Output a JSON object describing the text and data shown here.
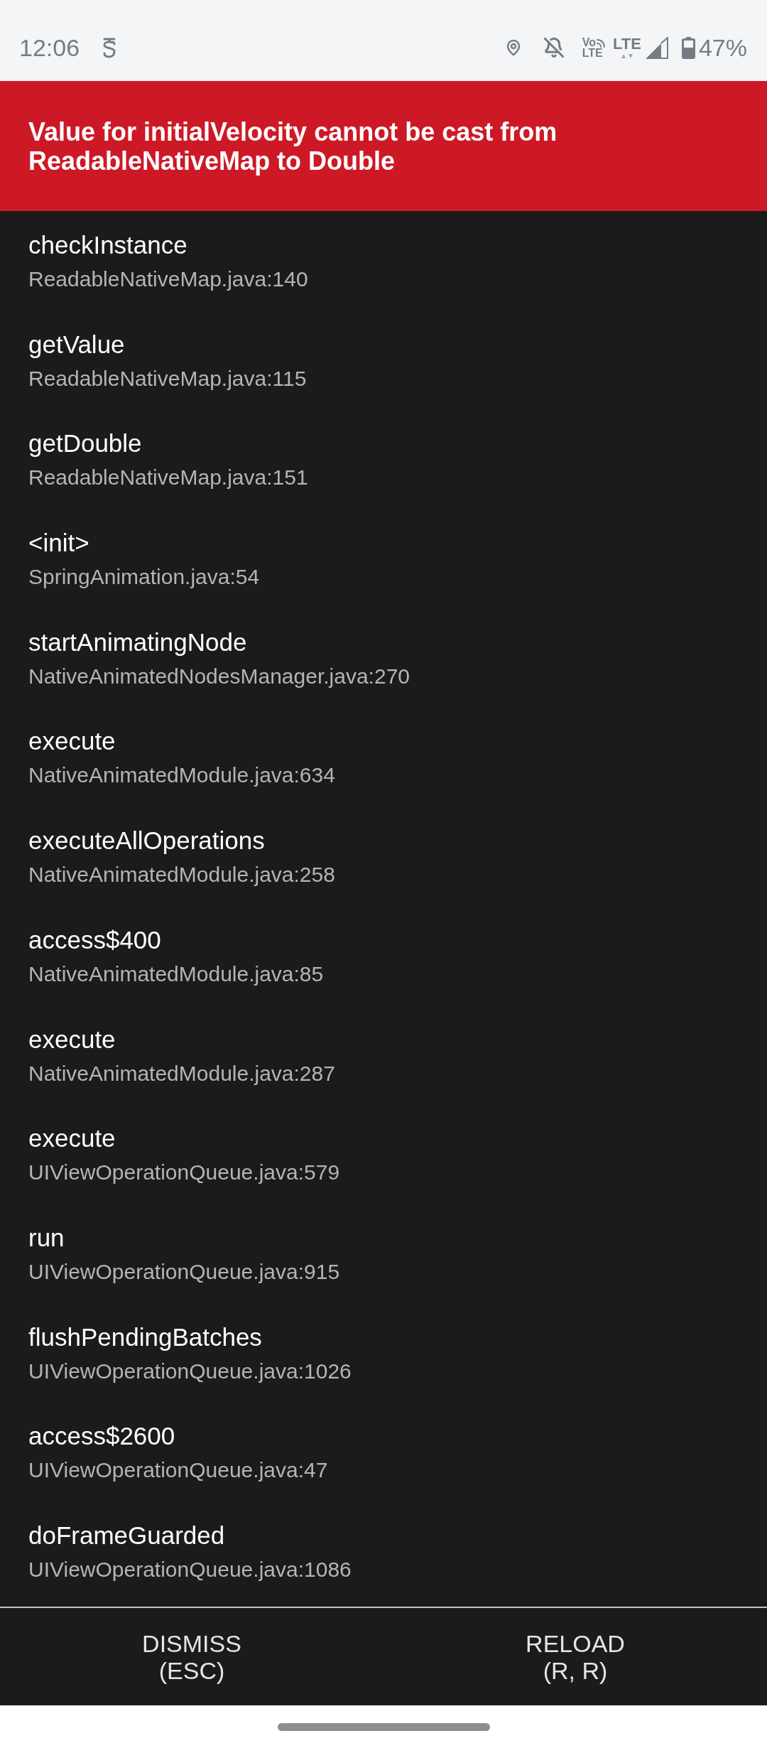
{
  "status_bar": {
    "time": "12:06",
    "volte_top": "Vo",
    "volte_bottom": "LTE",
    "network": "LTE",
    "battery": "47%"
  },
  "error": {
    "message": "Value for initialVelocity cannot be cast from ReadableNativeMap to Double"
  },
  "stack": [
    {
      "method": "checkInstance",
      "file": "ReadableNativeMap.java:140"
    },
    {
      "method": "getValue",
      "file": "ReadableNativeMap.java:115"
    },
    {
      "method": "getDouble",
      "file": "ReadableNativeMap.java:151"
    },
    {
      "method": "<init>",
      "file": "SpringAnimation.java:54"
    },
    {
      "method": "startAnimatingNode",
      "file": "NativeAnimatedNodesManager.java:270"
    },
    {
      "method": "execute",
      "file": "NativeAnimatedModule.java:634"
    },
    {
      "method": "executeAllOperations",
      "file": "NativeAnimatedModule.java:258"
    },
    {
      "method": "access$400",
      "file": "NativeAnimatedModule.java:85"
    },
    {
      "method": "execute",
      "file": "NativeAnimatedModule.java:287"
    },
    {
      "method": "execute",
      "file": "UIViewOperationQueue.java:579"
    },
    {
      "method": "run",
      "file": "UIViewOperationQueue.java:915"
    },
    {
      "method": "flushPendingBatches",
      "file": "UIViewOperationQueue.java:1026"
    },
    {
      "method": "access$2600",
      "file": "UIViewOperationQueue.java:47"
    },
    {
      "method": "doFrameGuarded",
      "file": "UIViewOperationQueue.java:1086"
    }
  ],
  "buttons": [
    {
      "label": "DISMISS",
      "shortcut": "(ESC)"
    },
    {
      "label": "RELOAD",
      "shortcut": "(R, R)"
    }
  ]
}
